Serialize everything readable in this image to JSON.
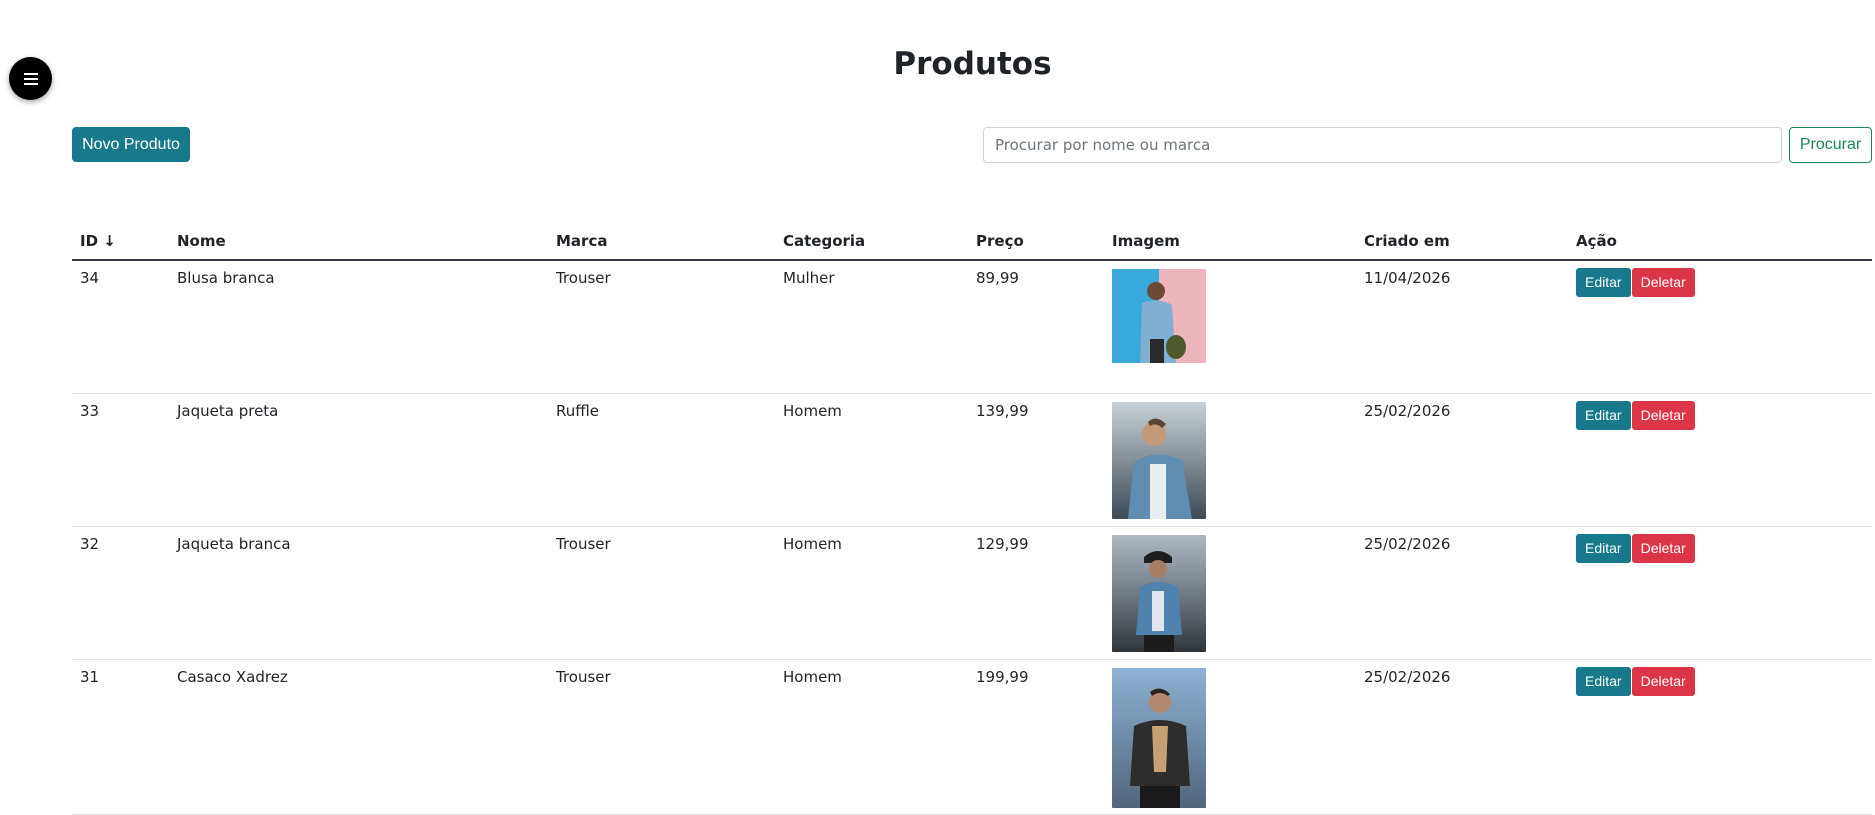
{
  "header": {
    "title": "Produtos"
  },
  "toolbar": {
    "new_label": "Novo Produto",
    "search_placeholder": "Procurar por nome ou marca",
    "search_label": "Procurar"
  },
  "table": {
    "columns": [
      "ID ↓",
      "Nome",
      "Marca",
      "Categoria",
      "Preço",
      "Imagem",
      "Criado em",
      "Ação"
    ],
    "rows": [
      {
        "id": "34",
        "nome": "Blusa branca",
        "marca": "Trouser",
        "categoria": "Mulher",
        "preco": "89,99",
        "criado": "11/04/2026",
        "edit": "Editar",
        "delete": "Deletar"
      },
      {
        "id": "33",
        "nome": "Jaqueta preta",
        "marca": "Ruffle",
        "categoria": "Homem",
        "preco": "139,99",
        "criado": "25/02/2026",
        "edit": "Editar",
        "delete": "Deletar"
      },
      {
        "id": "32",
        "nome": "Jaqueta branca",
        "marca": "Trouser",
        "categoria": "Homem",
        "preco": "129,99",
        "criado": "25/02/2026",
        "edit": "Editar",
        "delete": "Deletar"
      },
      {
        "id": "31",
        "nome": "Casaco Xadrez",
        "marca": "Trouser",
        "categoria": "Homem",
        "preco": "199,99",
        "criado": "25/02/2026",
        "edit": "Editar",
        "delete": "Deletar"
      }
    ]
  },
  "colors": {
    "primary": "#17798b",
    "danger": "#dc3545",
    "success": "#198754"
  },
  "icons": {
    "menu": "hamburger-menu-icon"
  }
}
